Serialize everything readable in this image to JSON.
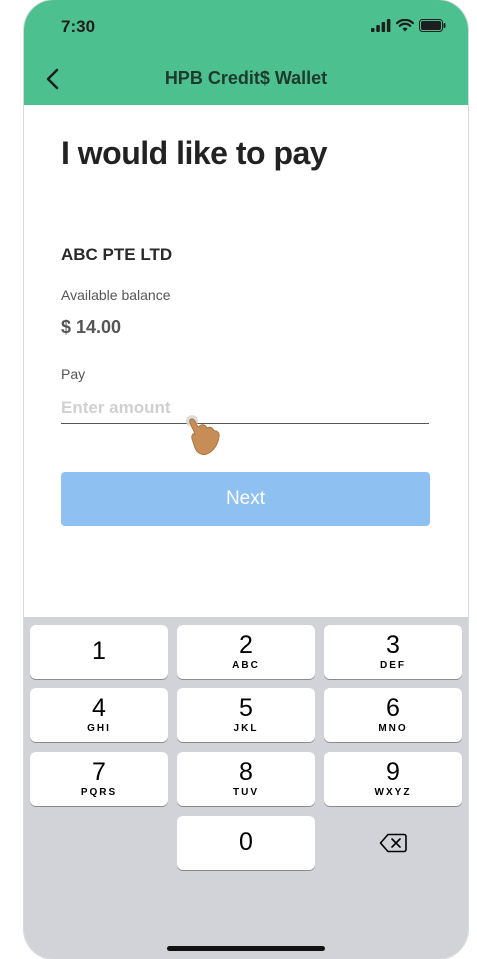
{
  "status_bar": {
    "time": "7:30"
  },
  "header": {
    "title": "HPB Credit$ Wallet"
  },
  "page": {
    "title": "I would like to pay",
    "merchant": "ABC PTE LTD",
    "balance_label": "Available balance",
    "balance_value": "$ 14.00",
    "pay_label": "Pay",
    "amount_placeholder": "Enter amount",
    "amount_value": "",
    "next_label": "Next"
  },
  "keypad": {
    "keys": [
      {
        "digit": "1",
        "letters": ""
      },
      {
        "digit": "2",
        "letters": "ABC"
      },
      {
        "digit": "3",
        "letters": "DEF"
      },
      {
        "digit": "4",
        "letters": "GHI"
      },
      {
        "digit": "5",
        "letters": "JKL"
      },
      {
        "digit": "6",
        "letters": "MNO"
      },
      {
        "digit": "7",
        "letters": "PQRS"
      },
      {
        "digit": "8",
        "letters": "TUV"
      },
      {
        "digit": "9",
        "letters": "WXYZ"
      },
      {
        "digit": "0",
        "letters": ""
      }
    ]
  },
  "colors": {
    "header": "#4cc08e",
    "button": "#8ec1f2",
    "keyboard": "#d2d3d8"
  },
  "icons": [
    "back-chevron-icon",
    "signal-icon",
    "wifi-icon",
    "battery-icon",
    "hand-pointer-icon",
    "backspace-icon"
  ]
}
